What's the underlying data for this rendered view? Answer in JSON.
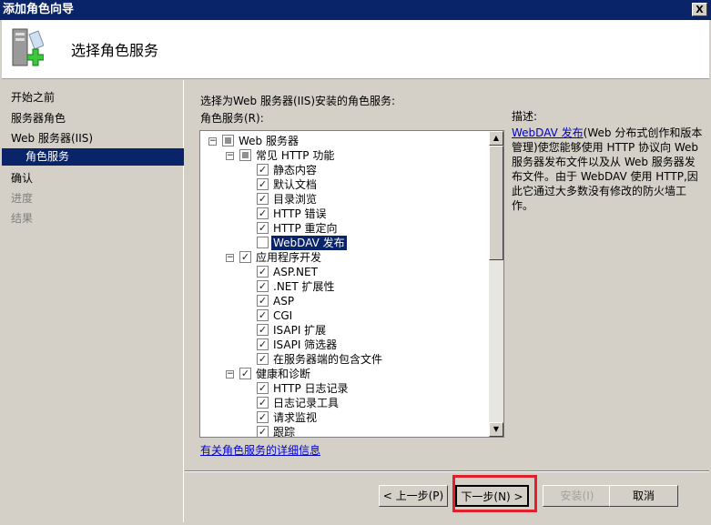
{
  "window": {
    "title": "添加角色向导",
    "close": "X"
  },
  "header": {
    "title": "选择角色服务"
  },
  "nav": [
    {
      "label": "开始之前",
      "state": "normal"
    },
    {
      "label": "服务器角色",
      "state": "normal"
    },
    {
      "label": "Web 服务器(IIS)",
      "state": "normal"
    },
    {
      "label": "角色服务",
      "state": "selected"
    },
    {
      "label": "确认",
      "state": "normal"
    },
    {
      "label": "进度",
      "state": "disabled"
    },
    {
      "label": "结果",
      "state": "disabled"
    }
  ],
  "main": {
    "intro": "选择为Web 服务器(IIS)安装的角色服务:",
    "list_label": "角色服务(R):",
    "more_info_link": "有关角色服务的详细信息"
  },
  "tree": [
    {
      "label": "Web 服务器",
      "level": 0,
      "expander": "⊟",
      "check": "partial"
    },
    {
      "label": "常见 HTTP 功能",
      "level": 1,
      "expander": "⊟",
      "check": "partial"
    },
    {
      "label": "静态内容",
      "level": 2,
      "check": "checked"
    },
    {
      "label": "默认文档",
      "level": 2,
      "check": "checked"
    },
    {
      "label": "目录浏览",
      "level": 2,
      "check": "checked"
    },
    {
      "label": "HTTP 错误",
      "level": 2,
      "check": "checked"
    },
    {
      "label": "HTTP 重定向",
      "level": 2,
      "check": "checked"
    },
    {
      "label": "WebDAV 发布",
      "level": 2,
      "check": "unchecked",
      "selected": true
    },
    {
      "label": "应用程序开发",
      "level": 1,
      "expander": "⊟",
      "check": "checked"
    },
    {
      "label": "ASP.NET",
      "level": 2,
      "check": "checked"
    },
    {
      "label": ".NET 扩展性",
      "level": 2,
      "check": "checked"
    },
    {
      "label": "ASP",
      "level": 2,
      "check": "checked"
    },
    {
      "label": "CGI",
      "level": 2,
      "check": "checked"
    },
    {
      "label": "ISAPI 扩展",
      "level": 2,
      "check": "checked"
    },
    {
      "label": "ISAPI 筛选器",
      "level": 2,
      "check": "checked"
    },
    {
      "label": "在服务器端的包含文件",
      "level": 2,
      "check": "checked"
    },
    {
      "label": "健康和诊断",
      "level": 1,
      "expander": "⊟",
      "check": "checked"
    },
    {
      "label": "HTTP 日志记录",
      "level": 2,
      "check": "checked"
    },
    {
      "label": "日志记录工具",
      "level": 2,
      "check": "checked"
    },
    {
      "label": "请求监视",
      "level": 2,
      "check": "checked"
    },
    {
      "label": "跟踪",
      "level": 2,
      "check": "checked"
    }
  ],
  "description": {
    "heading": "描述:",
    "link": "WebDAV 发布",
    "text": "(Web 分布式创作和版本管理)使您能够使用 HTTP 协议向 Web 服务器发布文件以及从 Web 服务器发布文件。由于 WebDAV 使用 HTTP,因此它通过大多数没有修改的防火墙工作。"
  },
  "buttons": {
    "prev": "< 上一步(P)",
    "next": "下一步(N) >",
    "install": "安装(I)",
    "cancel": "取消"
  },
  "colors": {
    "titlebar": "#0a246a",
    "highlight_box": "#e0202a"
  }
}
